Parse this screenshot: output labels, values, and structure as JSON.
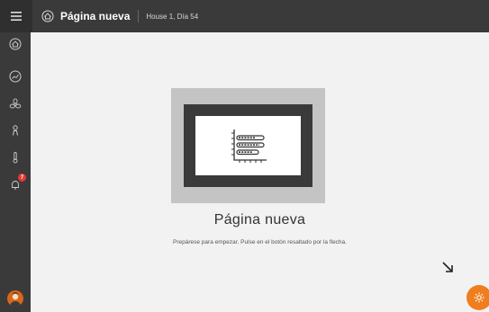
{
  "header": {
    "title": "Página nueva",
    "subtitle": "House 1, Día 54",
    "menu_icon": "hamburger-icon",
    "title_icon": "house-check-icon"
  },
  "sidebar": {
    "items": [
      {
        "icon": "house-check-icon"
      },
      {
        "icon": "house-chart-icon"
      },
      {
        "icon": "fan-icon"
      },
      {
        "icon": "person-icon"
      },
      {
        "icon": "thermometer-icon"
      },
      {
        "icon": "bell-icon",
        "badge": "7"
      }
    ],
    "avatar_icon": "user-avatar-icon"
  },
  "main": {
    "title": "Página nueva",
    "description": "Prepárese para empezar. Pulse en el botón resaltado por la flecha.",
    "illustration_icon": "chart-board-icon",
    "arrow_icon": "arrow-down-right-icon",
    "fab_icon": "settings-gear-icon"
  },
  "colors": {
    "topbar": "#3a3a3a",
    "background": "#f2f2f2",
    "accent": "#f07d1e",
    "badge": "#e53935"
  }
}
